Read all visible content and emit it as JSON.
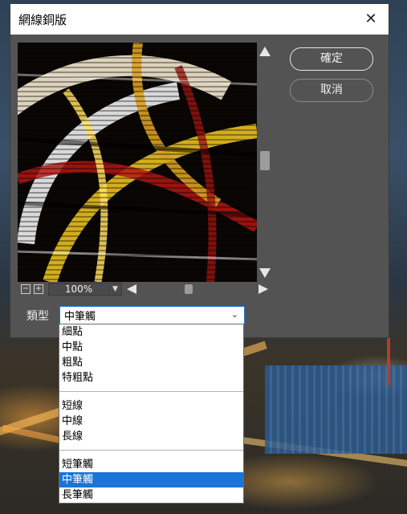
{
  "dialog": {
    "title": "網線銅版",
    "close_icon": "close-icon"
  },
  "buttons": {
    "ok": "確定",
    "cancel": "取消"
  },
  "zoom": {
    "value": "100%"
  },
  "type_control": {
    "label": "類型",
    "selected": "中筆觸"
  },
  "dropdown": {
    "groups": [
      [
        "細點",
        "中點",
        "粗點",
        "特粗點"
      ],
      [
        "短線",
        "中線",
        "長線"
      ],
      [
        "短筆觸",
        "中筆觸",
        "長筆觸"
      ]
    ],
    "highlighted": "中筆觸"
  },
  "colors": {
    "dialog_bg": "#535353",
    "titlebar_bg": "#ffffff",
    "selection_blue": "#1b74d8",
    "focus_border": "#1e74d6"
  }
}
